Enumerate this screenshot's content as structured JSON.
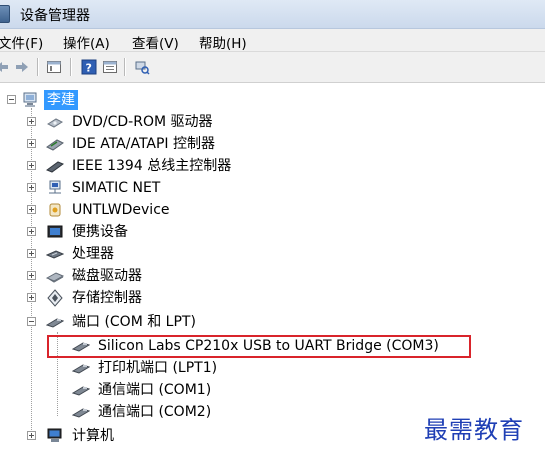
{
  "window": {
    "title": "设备管理器"
  },
  "menu": [
    "文件(F)",
    "操作(A)",
    "查看(V)",
    "帮助(H)"
  ],
  "toolbar": [
    "back-icon",
    "forward-icon",
    "properties-icon",
    "help-icon",
    "view-icon",
    "scan-hardware-icon"
  ],
  "tree": {
    "root": "李建",
    "categories": [
      {
        "label": "DVD/CD-ROM 驱动器",
        "icon": "dvd-drive-icon"
      },
      {
        "label": "IDE ATA/ATAPI 控制器",
        "icon": "ide-controller-icon"
      },
      {
        "label": "IEEE 1394 总线主控制器",
        "icon": "ieee1394-icon"
      },
      {
        "label": "SIMATIC NET",
        "icon": "network-icon"
      },
      {
        "label": "UNTLWDevice",
        "icon": "device-icon"
      },
      {
        "label": "便携设备",
        "icon": "portable-device-icon"
      },
      {
        "label": "处理器",
        "icon": "processor-icon"
      },
      {
        "label": "磁盘驱动器",
        "icon": "disk-drive-icon"
      },
      {
        "label": "存储控制器",
        "icon": "storage-controller-icon"
      },
      {
        "label": "端口 (COM 和 LPT)",
        "icon": "port-icon"
      }
    ],
    "ports": [
      "Silicon Labs CP210x USB to UART Bridge (COM3)",
      "打印机端口 (LPT1)",
      "通信端口 (COM1)",
      "通信端口 (COM2)"
    ],
    "last": {
      "label": "计算机",
      "icon": "computer-icon"
    }
  },
  "watermark": "最需教育",
  "colors": {
    "selection": "#3399ff",
    "highlight_border": "#d9242b",
    "watermark": "#1f3fb5"
  }
}
